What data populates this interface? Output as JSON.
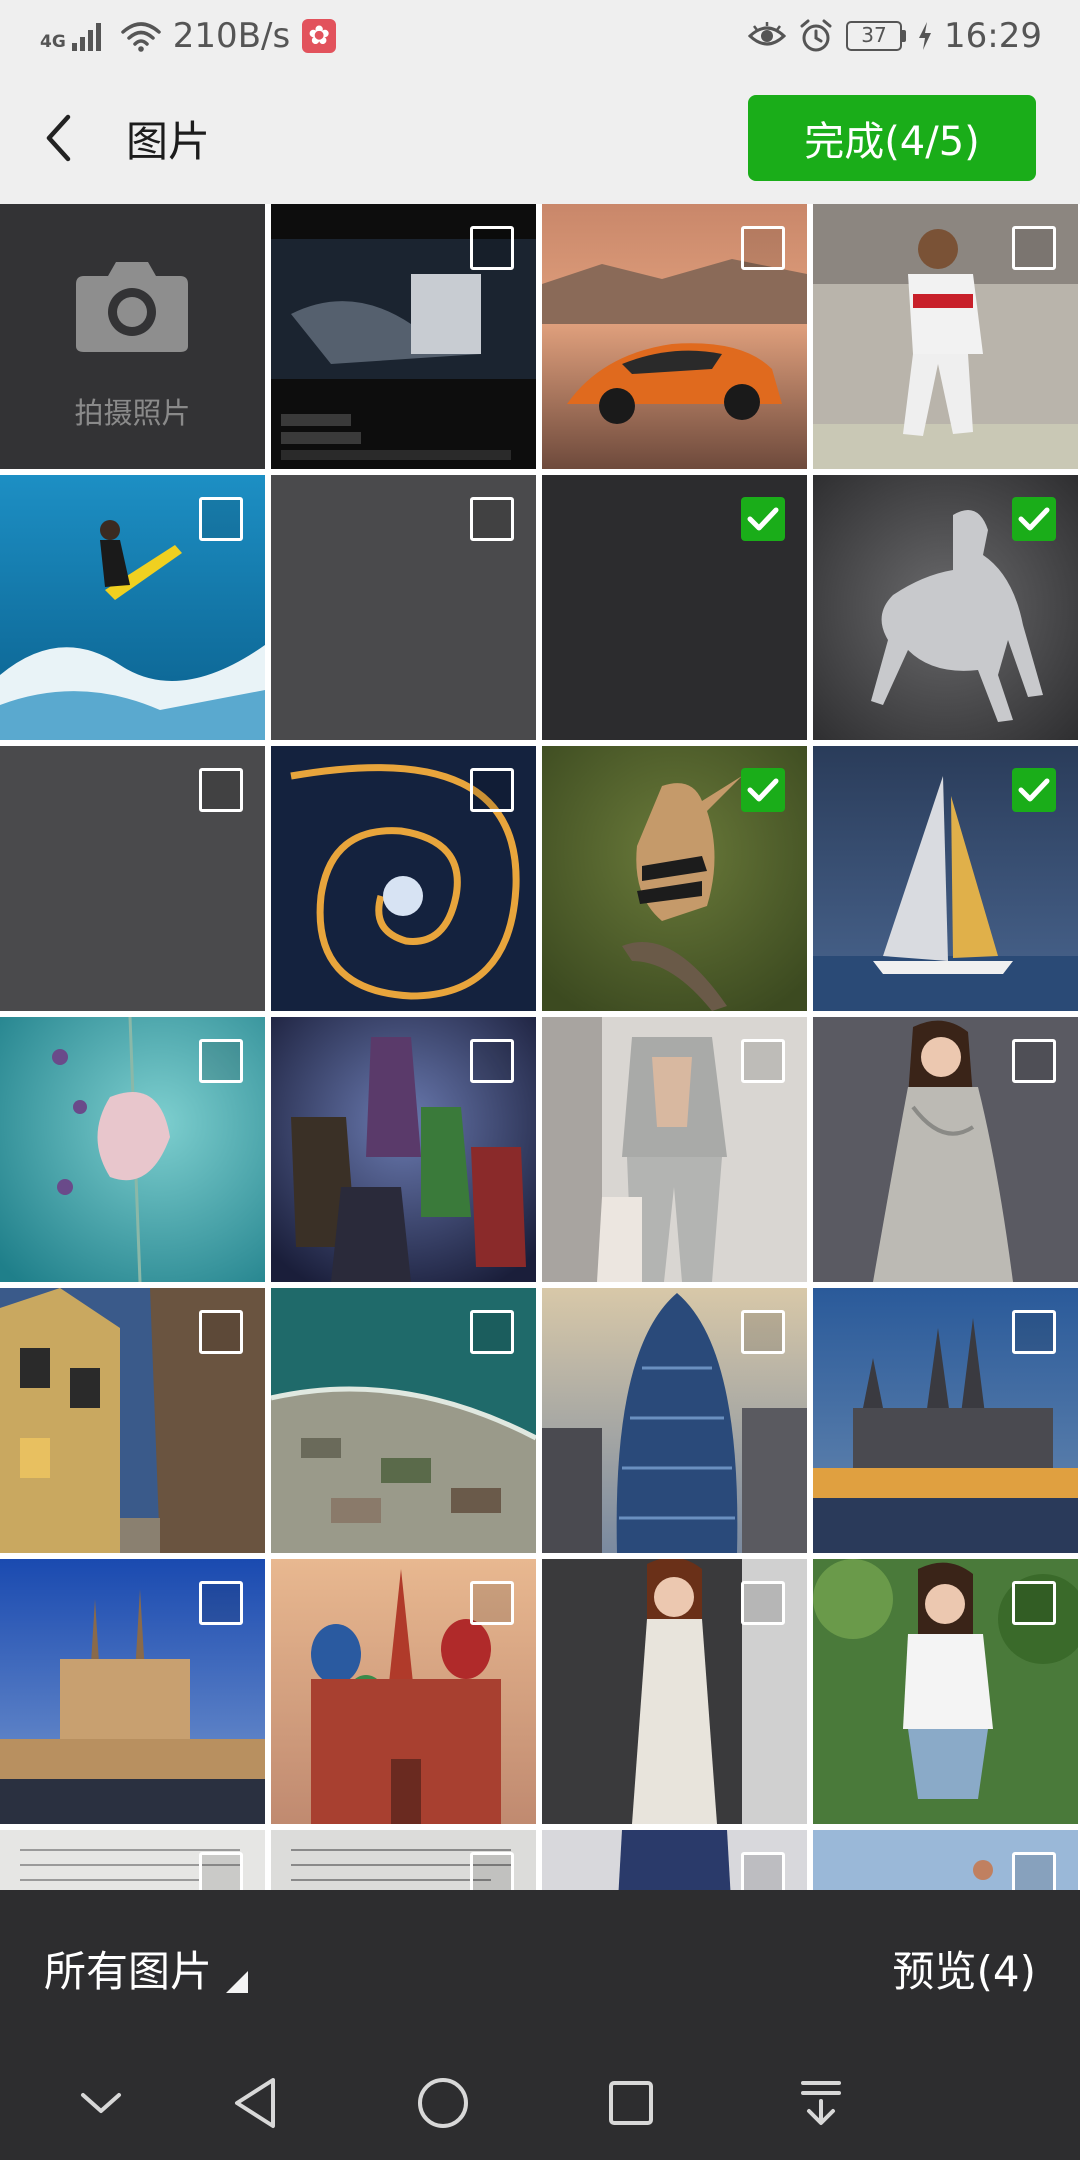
{
  "status_bar": {
    "network_type": "4G",
    "net_speed": "210B/s",
    "app_badge_icon": "pinduoduo-icon",
    "battery_level": "37",
    "time": "16:29"
  },
  "header": {
    "title": "图片",
    "done_label": "完成(4/5)"
  },
  "camera_cell": {
    "label": "拍摄照片"
  },
  "grid": {
    "items": [
      {
        "name": "video-screenshot-thumbnail",
        "checked": false
      },
      {
        "name": "orange-sports-car-thumbnail",
        "checked": false
      },
      {
        "name": "soccer-player-thumbnail",
        "checked": false
      },
      {
        "name": "kitesurfer-thumbnail",
        "checked": false
      },
      {
        "name": "blank-gray-thumbnail",
        "checked": false
      },
      {
        "name": "blank-dark-thumbnail",
        "checked": true
      },
      {
        "name": "white-horse-thumbnail",
        "checked": true
      },
      {
        "name": "blank-gray-thumbnail",
        "checked": false
      },
      {
        "name": "spiral-staircase-thumbnail",
        "checked": false
      },
      {
        "name": "hoopoe-bird-thumbnail",
        "checked": true
      },
      {
        "name": "sailboat-thumbnail",
        "checked": true
      },
      {
        "name": "butterfly-thumbnail",
        "checked": false
      },
      {
        "name": "superheroes-poster-thumbnail",
        "checked": false
      },
      {
        "name": "man-in-gray-suit-thumbnail",
        "checked": false
      },
      {
        "name": "woman-in-silver-dress-thumbnail",
        "checked": false
      },
      {
        "name": "old-town-street-thumbnail",
        "checked": false
      },
      {
        "name": "aerial-coastline-thumbnail",
        "checked": false
      },
      {
        "name": "gherkin-skyscraper-thumbnail",
        "checked": false
      },
      {
        "name": "cologne-cathedral-thumbnail",
        "checked": false
      },
      {
        "name": "church-at-dusk-thumbnail",
        "checked": false
      },
      {
        "name": "st-basils-cathedral-thumbnail",
        "checked": false
      },
      {
        "name": "woman-in-white-dress-thumbnail",
        "checked": false
      },
      {
        "name": "woman-in-garden-thumbnail",
        "checked": false
      },
      {
        "name": "document-scan-thumbnail",
        "checked": false
      },
      {
        "name": "document-scan-thumbnail",
        "checked": false
      },
      {
        "name": "woman-in-blazer-thumbnail",
        "checked": false
      },
      {
        "name": "outdoor-photo-thumbnail",
        "checked": false
      }
    ]
  },
  "bottom_bar": {
    "album_label": "所有图片",
    "preview_label": "预览(4)"
  },
  "nav_bar": {
    "icons": [
      "chevron-down-icon",
      "back-triangle-icon",
      "home-circle-icon",
      "recents-square-icon",
      "notification-pull-icon"
    ]
  },
  "colors": {
    "accent": "#1aad19",
    "bottom_bar_bg": "#2d2d2f",
    "header_bg": "#efefef"
  }
}
